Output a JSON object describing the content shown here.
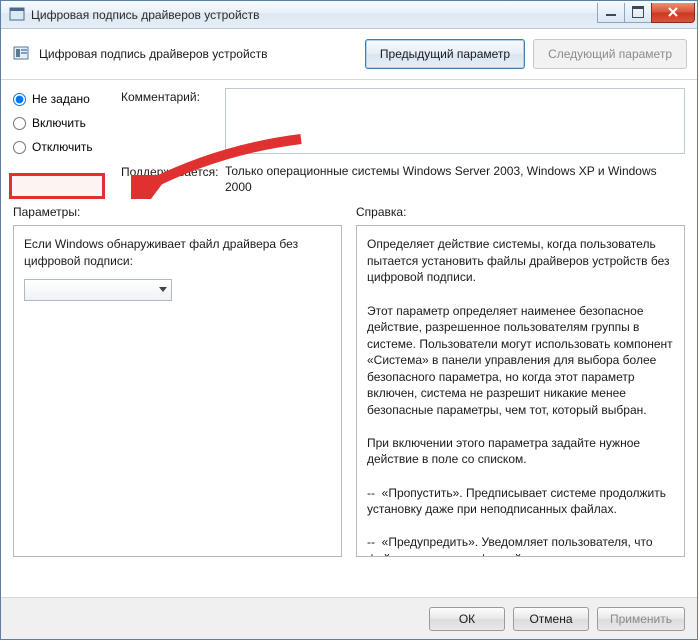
{
  "window": {
    "title": "Цифровая подпись драйверов устройств"
  },
  "header": {
    "title": "Цифровая подпись драйверов устройств",
    "prev": "Предыдущий параметр",
    "next": "Следующий параметр"
  },
  "radios": {
    "not_configured": "Не задано",
    "enabled": "Включить",
    "disabled": "Отключить"
  },
  "fields": {
    "comment_label": "Комментарий:",
    "comment_value": "",
    "supported_label": "Поддерживается:",
    "supported_value": "Только операционные системы Windows Server 2003, Windows XP и Windows 2000"
  },
  "columns": {
    "params_label": "Параметры:",
    "help_label": "Справка:"
  },
  "params": {
    "text": "Если Windows обнаруживает файл драйвера без цифровой подписи:",
    "combo_value": ""
  },
  "help": {
    "text": "Определяет действие системы, когда пользователь пытается установить файлы драйверов устройств без цифровой подписи.\n\nЭтот параметр определяет наименее безопасное действие, разрешенное пользователям группы в системе. Пользователи могут использовать компонент «Система» в панели управления для выбора более безопасного параметра, но когда этот параметр включен, система не разрешит никакие менее безопасные параметры, чем тот, который выбран.\n\nПри включении этого параметра задайте нужное действие в поле со списком.\n\n--  «Пропустить». Предписывает системе продолжить установку даже при неподписанных файлах.\n\n--  «Предупредить». Уведомляет пользователя, что файлы не имеют цифровой подписи, и предоставляет пользователю"
  },
  "footer": {
    "ok": "ОК",
    "cancel": "Отмена",
    "apply": "Применить"
  }
}
